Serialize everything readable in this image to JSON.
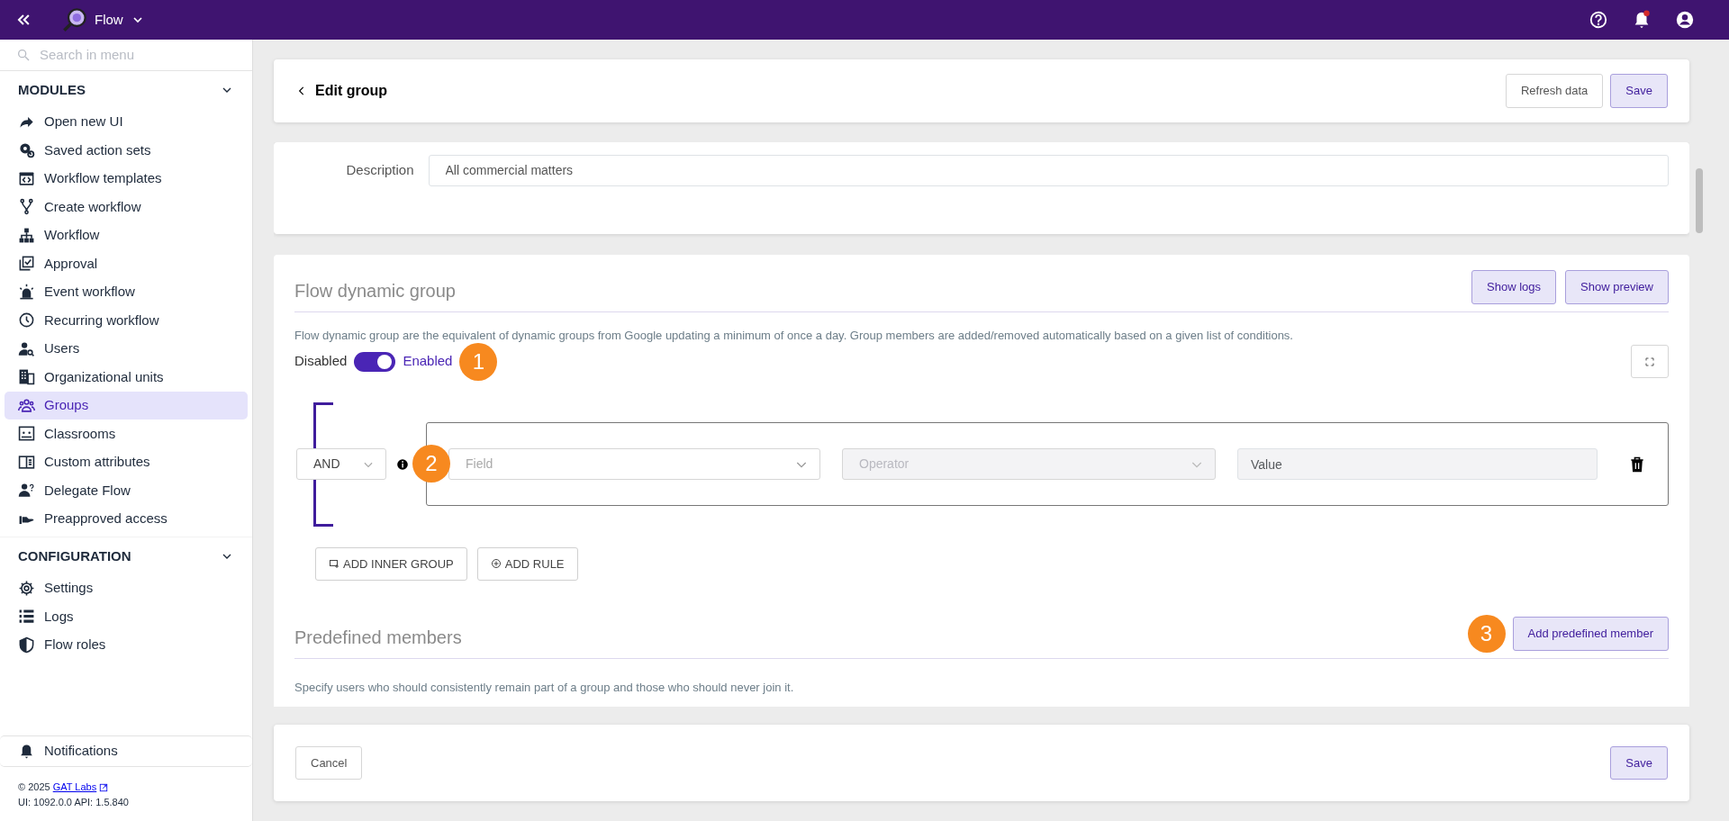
{
  "app": {
    "title": "Flow",
    "notifications_unread": true
  },
  "sidebar": {
    "search": {
      "placeholder": "Search in menu"
    },
    "sections": [
      {
        "title": "MODULES",
        "expanded": true,
        "items": [
          {
            "label": "Open new UI",
            "selected": false
          },
          {
            "label": "Saved action sets",
            "selected": false
          },
          {
            "label": "Workflow templates",
            "selected": false
          },
          {
            "label": "Create workflow",
            "selected": false
          },
          {
            "label": "Workflow",
            "selected": false
          },
          {
            "label": "Approval",
            "selected": false
          },
          {
            "label": "Event workflow",
            "selected": false
          },
          {
            "label": "Recurring workflow",
            "selected": false
          },
          {
            "label": "Users",
            "selected": false
          },
          {
            "label": "Organizational units",
            "selected": false
          },
          {
            "label": "Groups",
            "selected": true
          },
          {
            "label": "Classrooms",
            "selected": false
          },
          {
            "label": "Custom attributes",
            "selected": false
          },
          {
            "label": "Delegate Flow",
            "selected": false
          },
          {
            "label": "Preapproved access",
            "selected": false
          }
        ]
      },
      {
        "title": "CONFIGURATION",
        "expanded": true,
        "items": [
          {
            "label": "Settings",
            "selected": false
          },
          {
            "label": "Logs",
            "selected": false
          },
          {
            "label": "Flow roles",
            "selected": false
          }
        ]
      }
    ],
    "notifications": "Notifications",
    "footer": {
      "copyright": "© 2025",
      "link": "GAT Labs",
      "version": "UI: 1092.0.0 API: 1.5.840"
    }
  },
  "page": {
    "title": "Edit group",
    "buttons": [
      "Refresh data",
      "Save"
    ]
  },
  "description": {
    "label": "Description",
    "value": "All commercial matters"
  },
  "dynamic_group": {
    "title": "Flow dynamic group",
    "buttons": [
      "Show logs",
      "Show preview"
    ],
    "text": "Flow dynamic group are the equivalent of dynamic groups from Google updating a minimum of once a day. Group members are added/removed automatically based on a given list of conditions.",
    "toggle": {
      "off_label": "Disabled",
      "on_label": "Enabled",
      "on": true,
      "callout": "1"
    },
    "query": {
      "combinator": "AND",
      "callout": "2",
      "rules": [
        {
          "field": {
            "placeholder": "Field",
            "disabled": false
          },
          "operator": {
            "placeholder": "Operator",
            "disabled": true
          },
          "value": {
            "placeholder": "Value",
            "disabled": true
          }
        }
      ],
      "buttons": [
        "ADD INNER GROUP",
        "ADD RULE"
      ]
    }
  },
  "predefined": {
    "title": "Predefined members",
    "button": "Add predefined member",
    "callout": "3",
    "text": "Specify users who should consistently remain part of a group and those who should never join it."
  },
  "footer": {
    "buttons": [
      "Cancel",
      "Save"
    ]
  }
}
